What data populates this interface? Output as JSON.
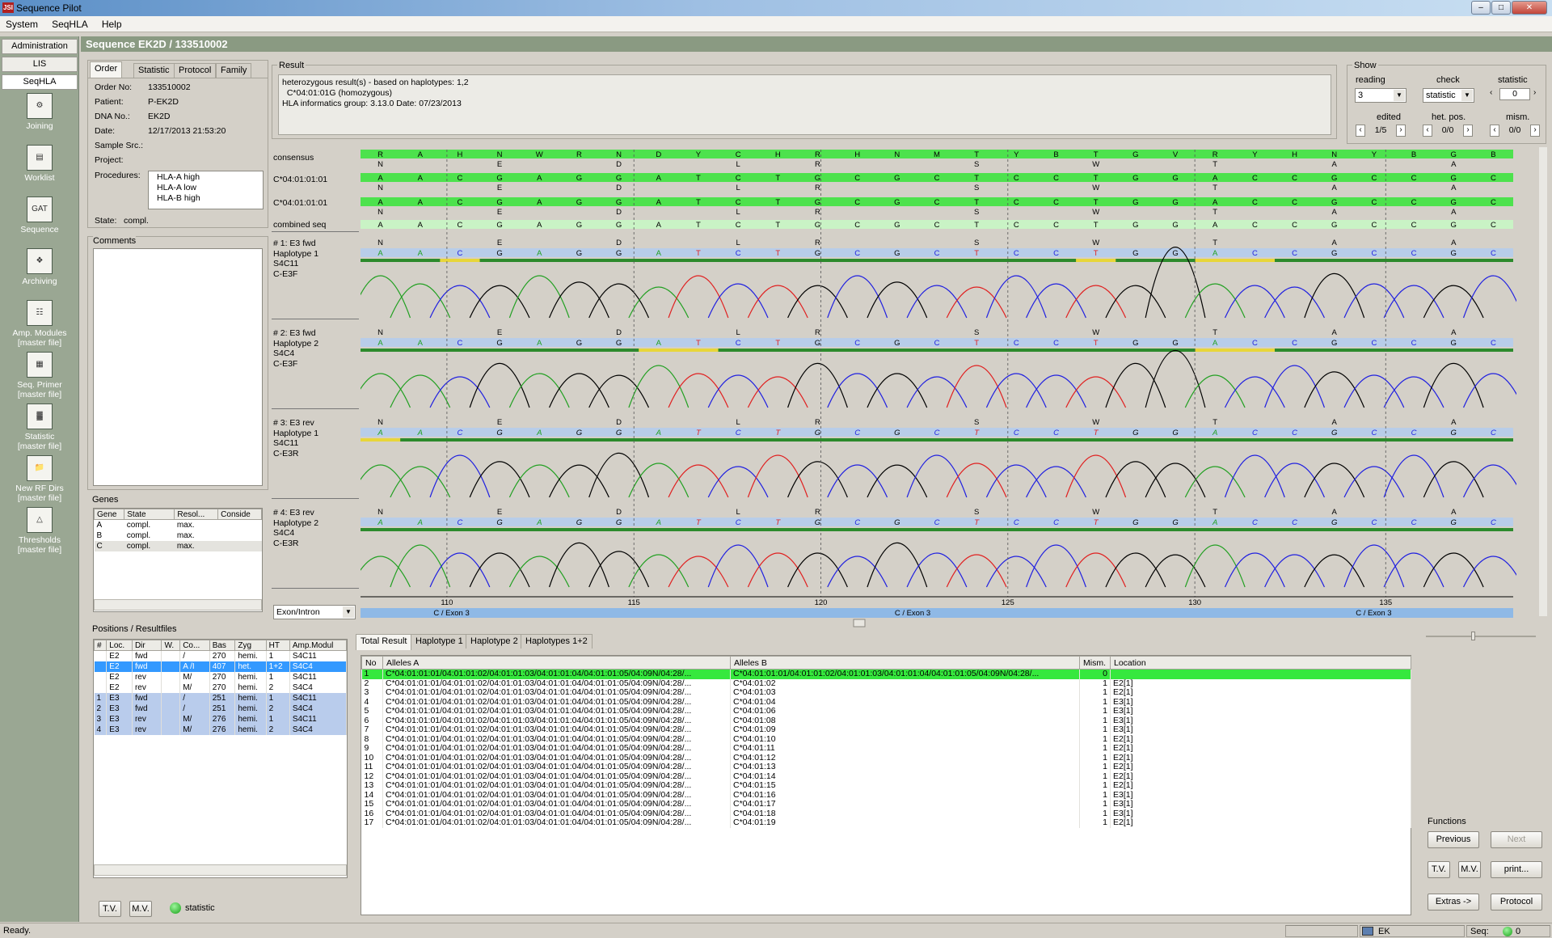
{
  "window": {
    "title": "Sequence Pilot",
    "logo": "JSI"
  },
  "menu": [
    "System",
    "SeqHLA",
    "Help"
  ],
  "nav": {
    "buttons": [
      "Administration",
      "LIS",
      "SeqHLA"
    ],
    "items": [
      {
        "label": "Joining",
        "icon": "joining-icon"
      },
      {
        "label": "Worklist",
        "icon": "worklist-icon"
      },
      {
        "label": "Sequence",
        "icon": "sequence-icon"
      },
      {
        "label": "Archiving",
        "icon": "archiving-icon"
      },
      {
        "label": "Amp. Modules\n[master file]",
        "icon": "amp-modules-icon"
      },
      {
        "label": "Seq. Primer\n[master file]",
        "icon": "seq-primer-icon"
      },
      {
        "label": "Statistic\n[master file]",
        "icon": "statistic-icon"
      },
      {
        "label": "New RF Dirs\n[master file]",
        "icon": "new-rf-dirs-icon"
      },
      {
        "label": "Thresholds\n[master file]",
        "icon": "thresholds-icon"
      }
    ]
  },
  "header": {
    "title": "Sequence EK2D / 133510002"
  },
  "order": {
    "tabs": [
      "Order",
      "Statistic",
      "Protocol",
      "Family"
    ],
    "fields": [
      {
        "label": "Order No:",
        "value": "133510002"
      },
      {
        "label": "Patient:",
        "value": "P-EK2D"
      },
      {
        "label": "DNA No.:",
        "value": "EK2D"
      },
      {
        "label": "Date:",
        "value": "12/17/2013 21:53:20"
      },
      {
        "label": "Sample Src.:",
        "value": ""
      },
      {
        "label": "Project:",
        "value": ""
      }
    ],
    "procedures_label": "Procedures:",
    "procedures": [
      "HLA-A high",
      "HLA-A low",
      "HLA-B high"
    ],
    "state_label": "State:",
    "state": "compl."
  },
  "comments": {
    "title": "Comments"
  },
  "genes": {
    "title": "Genes",
    "columns": [
      "Gene",
      "State",
      "Resol...",
      "Conside"
    ],
    "rows": [
      [
        "A",
        "compl.",
        "max.",
        ""
      ],
      [
        "B",
        "compl.",
        "max.",
        ""
      ],
      [
        "C",
        "compl.",
        "max.",
        ""
      ]
    ]
  },
  "positions": {
    "title": "Positions / Resultfiles",
    "columns": [
      "#",
      "Loc.",
      "Dir",
      "W.",
      "Co...",
      "Bas",
      "Zyg",
      "HT",
      "Amp.Modul"
    ],
    "rows": [
      {
        "c": [
          "",
          "E2",
          "fwd",
          "",
          "/",
          "270",
          "hemi.",
          "1",
          "S4C11"
        ],
        "style": ""
      },
      {
        "c": [
          "",
          "E2",
          "fwd",
          "",
          "A /I",
          "407",
          "het.",
          "1+2",
          "S4C4"
        ],
        "style": "sel"
      },
      {
        "c": [
          "",
          "E2",
          "rev",
          "",
          "M/",
          "270",
          "hemi.",
          "1",
          "S4C11"
        ],
        "style": ""
      },
      {
        "c": [
          "",
          "E2",
          "rev",
          "",
          "M/",
          "270",
          "hemi.",
          "2",
          "S4C4"
        ],
        "style": ""
      },
      {
        "c": [
          "1",
          "E3",
          "fwd",
          "",
          "/",
          "251",
          "hemi.",
          "1",
          "S4C11"
        ],
        "style": "hl"
      },
      {
        "c": [
          "2",
          "E3",
          "fwd",
          "",
          "/",
          "251",
          "hemi.",
          "2",
          "S4C4"
        ],
        "style": "hl"
      },
      {
        "c": [
          "3",
          "E3",
          "rev",
          "",
          "M/",
          "276",
          "hemi.",
          "1",
          "S4C11"
        ],
        "style": "hl"
      },
      {
        "c": [
          "4",
          "E3",
          "rev",
          "",
          "M/",
          "276",
          "hemi.",
          "2",
          "S4C4"
        ],
        "style": "hl"
      }
    ],
    "tv": "T.V.",
    "mv": "M.V.",
    "statistic": "statistic"
  },
  "result": {
    "title": "Result",
    "lines": [
      "heterozygous result(s) - based on haplotypes:  1,2",
      "  C*04:01:01G (homozygous)",
      "HLA informatics group: 3.13.0 Date: 07/23/2013"
    ]
  },
  "show": {
    "title": "Show",
    "reading_label": "reading",
    "reading": "3",
    "check_label": "check",
    "check": "statistic",
    "statistic_label": "statistic",
    "statistic": "0",
    "edited_label": "edited",
    "edited": "1/5",
    "hetpos_label": "het. pos.",
    "hetpos": "0/0",
    "mism_label": "mism.",
    "mism": "0/0"
  },
  "alignment": {
    "labels": {
      "consensus": "consensus",
      "allele1": "C*04:01:01:01",
      "allele2": "C*04:01:01:01",
      "combined": "combined seq"
    },
    "consensus": [
      "R",
      "A",
      "H",
      "N",
      "W",
      "R",
      "N",
      "D",
      "Y",
      "C",
      "H",
      "R",
      "H",
      "N",
      "M",
      "T",
      "Y",
      "B",
      "T",
      "G",
      "V",
      "R",
      "Y",
      "H",
      "N",
      "Y",
      "B",
      "G",
      "B"
    ],
    "ambig": [
      "N",
      "",
      "",
      "E",
      "",
      "",
      "D",
      "",
      "",
      "L",
      "",
      "R",
      "",
      "",
      "",
      "S",
      "",
      "",
      "W",
      "",
      "",
      "T",
      "",
      "",
      "A",
      "",
      "",
      "A",
      ""
    ],
    "allele": [
      "A",
      "A",
      "C",
      "G",
      "A",
      "G",
      "G",
      "A",
      "T",
      "C",
      "T",
      "G",
      "C",
      "G",
      "C",
      "T",
      "C",
      "C",
      "T",
      "G",
      "G",
      "A",
      "C",
      "C",
      "G",
      "C",
      "C",
      "G",
      "C"
    ],
    "traces": [
      {
        "label": "# 1: E3 fwd",
        "hap": "Haplotype 1",
        "amp": "S4C11",
        "primer": "C-E3F"
      },
      {
        "label": "# 2: E3 fwd",
        "hap": "Haplotype 2",
        "amp": "S4C4",
        "primer": "C-E3F"
      },
      {
        "label": "# 3: E3 rev",
        "hap": "Haplotype 1",
        "amp": "S4C11",
        "primer": "C-E3R"
      },
      {
        "label": "# 4: E3 rev",
        "hap": "Haplotype 2",
        "amp": "S4C4",
        "primer": "C-E3R"
      }
    ],
    "ruler": [
      "110",
      "115",
      "120",
      "125",
      "130",
      "135"
    ],
    "exon_select": "Exon/Intron",
    "exon_labels": [
      "C / Exon 3",
      "C / Exon 3",
      "C / Exon 3"
    ]
  },
  "results_tabs": [
    "Total Result",
    "Haplotype 1",
    "Haplotype 2",
    "Haplotypes 1+2"
  ],
  "results": {
    "columns": [
      "No",
      "Alleles A",
      "Alleles B",
      "Mism.",
      "Location"
    ],
    "rows": [
      [
        "1",
        "C*04:01:01:01/04:01:01:02/04:01:01:03/04:01:01:04/04:01:01:05/04:09N/04:28/...",
        "C*04:01:01:01/04:01:01:02/04:01:01:03/04:01:01:04/04:01:01:05/04:09N/04:28/...",
        "0",
        ""
      ],
      [
        "2",
        "C*04:01:01:01/04:01:01:02/04:01:01:03/04:01:01:04/04:01:01:05/04:09N/04:28/...",
        "C*04:01:02",
        "1",
        "E2[1]"
      ],
      [
        "3",
        "C*04:01:01:01/04:01:01:02/04:01:01:03/04:01:01:04/04:01:01:05/04:09N/04:28/...",
        "C*04:01:03",
        "1",
        "E2[1]"
      ],
      [
        "4",
        "C*04:01:01:01/04:01:01:02/04:01:01:03/04:01:01:04/04:01:01:05/04:09N/04:28/...",
        "C*04:01:04",
        "1",
        "E3[1]"
      ],
      [
        "5",
        "C*04:01:01:01/04:01:01:02/04:01:01:03/04:01:01:04/04:01:01:05/04:09N/04:28/...",
        "C*04:01:06",
        "1",
        "E3[1]"
      ],
      [
        "6",
        "C*04:01:01:01/04:01:01:02/04:01:01:03/04:01:01:04/04:01:01:05/04:09N/04:28/...",
        "C*04:01:08",
        "1",
        "E3[1]"
      ],
      [
        "7",
        "C*04:01:01:01/04:01:01:02/04:01:01:03/04:01:01:04/04:01:01:05/04:09N/04:28/...",
        "C*04:01:09",
        "1",
        "E3[1]"
      ],
      [
        "8",
        "C*04:01:01:01/04:01:01:02/04:01:01:03/04:01:01:04/04:01:01:05/04:09N/04:28/...",
        "C*04:01:10",
        "1",
        "E2[1]"
      ],
      [
        "9",
        "C*04:01:01:01/04:01:01:02/04:01:01:03/04:01:01:04/04:01:01:05/04:09N/04:28/...",
        "C*04:01:11",
        "1",
        "E2[1]"
      ],
      [
        "10",
        "C*04:01:01:01/04:01:01:02/04:01:01:03/04:01:01:04/04:01:01:05/04:09N/04:28/...",
        "C*04:01:12",
        "1",
        "E2[1]"
      ],
      [
        "11",
        "C*04:01:01:01/04:01:01:02/04:01:01:03/04:01:01:04/04:01:01:05/04:09N/04:28/...",
        "C*04:01:13",
        "1",
        "E2[1]"
      ],
      [
        "12",
        "C*04:01:01:01/04:01:01:02/04:01:01:03/04:01:01:04/04:01:01:05/04:09N/04:28/...",
        "C*04:01:14",
        "1",
        "E2[1]"
      ],
      [
        "13",
        "C*04:01:01:01/04:01:01:02/04:01:01:03/04:01:01:04/04:01:01:05/04:09N/04:28/...",
        "C*04:01:15",
        "1",
        "E2[1]"
      ],
      [
        "14",
        "C*04:01:01:01/04:01:01:02/04:01:01:03/04:01:01:04/04:01:01:05/04:09N/04:28/...",
        "C*04:01:16",
        "1",
        "E3[1]"
      ],
      [
        "15",
        "C*04:01:01:01/04:01:01:02/04:01:01:03/04:01:01:04/04:01:01:05/04:09N/04:28/...",
        "C*04:01:17",
        "1",
        "E3[1]"
      ],
      [
        "16",
        "C*04:01:01:01/04:01:01:02/04:01:01:03/04:01:01:04/04:01:01:05/04:09N/04:28/...",
        "C*04:01:18",
        "1",
        "E3[1]"
      ],
      [
        "17",
        "C*04:01:01:01/04:01:01:02/04:01:01:03/04:01:01:04/04:01:01:05/04:09N/04:28/...",
        "C*04:01:19",
        "1",
        "E2[1]"
      ]
    ]
  },
  "functions": {
    "title": "Functions",
    "previous": "Previous",
    "next": "Next",
    "tv": "T.V.",
    "mv": "M.V.",
    "print": "print...",
    "extras": "Extras ->",
    "protocol": "Protocol"
  },
  "status": {
    "text": "Ready.",
    "user": "EK",
    "seq_label": "Seq:",
    "seq_value": "0"
  },
  "colors": {
    "nav_bg": "#9aa793",
    "header_bg": "#8a9a82",
    "consensus_green": "#4de24d",
    "selection_blue": "#3399ff",
    "base_A": "#22a022",
    "base_C": "#2020e0",
    "base_G": "#000000",
    "base_T": "#e02020"
  }
}
